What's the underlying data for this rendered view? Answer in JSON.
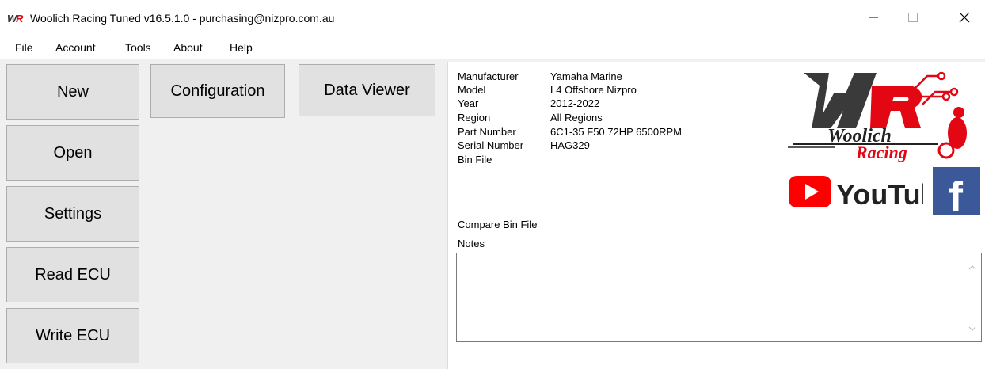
{
  "window": {
    "title": "Woolich Racing Tuned v16.5.1.0 - purchasing@nizpro.com.au"
  },
  "menu": {
    "file": "File",
    "account": "Account",
    "tools": "Tools",
    "about": "About",
    "help": "Help"
  },
  "buttons": {
    "new": "New",
    "open": "Open",
    "settings": "Settings",
    "read_ecu": "Read ECU",
    "write_ecu": "Write ECU",
    "configuration": "Configuration",
    "data_viewer": "Data Viewer"
  },
  "info": {
    "manufacturer_label": "Manufacturer",
    "manufacturer_value": "Yamaha Marine",
    "model_label": "Model",
    "model_value": "L4 Offshore Nizpro",
    "year_label": "Year",
    "year_value": "2012-2022",
    "region_label": "Region",
    "region_value": "All Regions",
    "part_number_label": "Part Number",
    "part_number_value": "6C1-35 F50 72HP 6500RPM",
    "serial_number_label": "Serial Number",
    "serial_number_value": "HAG329",
    "bin_file_label": "Bin File",
    "compare_bin_file_label": "Compare Bin File",
    "notes_label": "Notes",
    "notes_value": ""
  },
  "logos": {
    "wr_logo_text": "Woolich Racing",
    "youtube_text": "YouTube",
    "facebook_text": "f"
  },
  "colors": {
    "button_bg": "#e1e1e1",
    "button_border": "#adadad",
    "youtube_red": "#ff0000",
    "facebook_blue": "#3b5998",
    "woolich_red": "#e30613"
  }
}
